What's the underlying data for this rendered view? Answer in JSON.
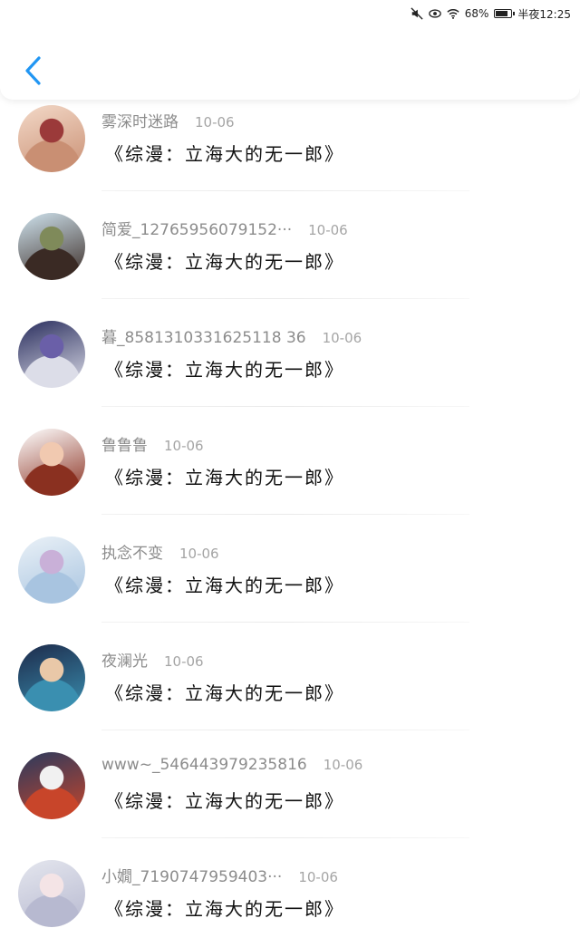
{
  "status_bar": {
    "battery": "68%",
    "battery_level": 0.68,
    "time": "半夜12:25"
  },
  "header": {
    "accent_color": "#2196F3"
  },
  "comments": [
    {
      "username": "雾深时迷路",
      "date": "10-06",
      "content": "《综漫：立海大的无一郎》",
      "avatar_colors": [
        "#f3d9c8",
        "#c98f73",
        "#9b3a3a"
      ]
    },
    {
      "username": "简爱_12765956079152···",
      "date": "10-06",
      "content": "《综漫：立海大的无一郎》",
      "avatar_colors": [
        "#cfe3ee",
        "#3a2a24",
        "#7f8a5a"
      ]
    },
    {
      "username": "暮_8581310331625118 36",
      "date": "10-06",
      "content": "《综漫：立海大的无一郎》",
      "avatar_colors": [
        "#2a2e5e",
        "#dcdde8",
        "#6a5fa8"
      ]
    },
    {
      "username": "鲁鲁鲁",
      "date": "10-06",
      "content": "《综漫：立海大的无一郎》",
      "avatar_colors": [
        "#ffffff",
        "#8a3020",
        "#f1c9b0"
      ]
    },
    {
      "username": "执念不变",
      "date": "10-06",
      "content": "《综漫：立海大的无一郎》",
      "avatar_colors": [
        "#eaf1f7",
        "#a8c4e0",
        "#c9b0d8"
      ]
    },
    {
      "username": "夜澜光",
      "date": "10-06",
      "content": "《综漫：立海大的无一郎》",
      "avatar_colors": [
        "#1d2a4a",
        "#3a8fb0",
        "#e9c8a8"
      ]
    },
    {
      "username": "www~_546443979235816",
      "date": "10-06",
      "content": "《综漫：立海大的无一郎》",
      "avatar_colors": [
        "#2a3a5e",
        "#c8452a",
        "#f1f1f1"
      ]
    },
    {
      "username": "小嫺_7190747959403···",
      "date": "10-06",
      "content": "《综漫：立海大的无一郎》",
      "avatar_colors": [
        "#e4e6ee",
        "#b7b9d0",
        "#f4e4e6"
      ]
    }
  ]
}
